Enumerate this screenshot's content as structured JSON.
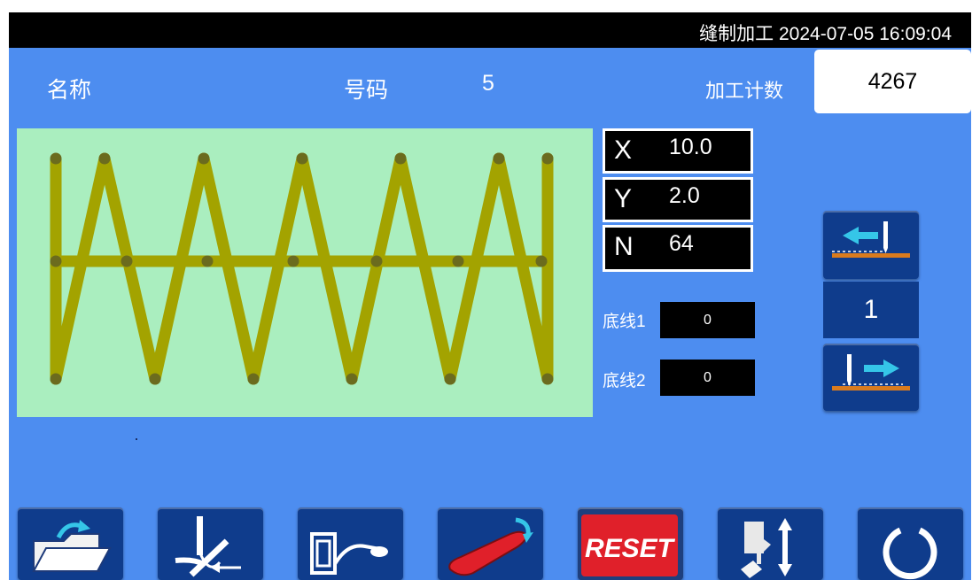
{
  "status": {
    "mode": "缝制加工",
    "datetime": "2024-07-05 16:09:04"
  },
  "header": {
    "name_label": "名称",
    "number_label": "号码",
    "number_value": "5",
    "count_label": "加工计数",
    "count_value": "4267"
  },
  "coords": {
    "x_label": "X",
    "x_value": "10.0",
    "y_label": "Y",
    "y_value": "2.0",
    "n_label": "N",
    "n_value": "64"
  },
  "bobbin": {
    "b1_label": "底线1",
    "b1_value": "0",
    "b2_label": "底线2",
    "b2_value": "0"
  },
  "stepper": {
    "value": "1"
  },
  "toolbar": {
    "reset_label": "RESET"
  },
  "icons": [
    "folder-open-icon",
    "thread-trim-icon",
    "clamp-icon",
    "presser-foot-icon",
    "reset-icon",
    "needle-up-down-icon",
    "power-cycle-icon",
    "needle-back-icon",
    "needle-forward-icon"
  ],
  "colors": {
    "status_bar": "#000000",
    "panel_bg": "#4d8df0",
    "pattern_bg": "#aaeebf",
    "stitch_line": "#a3a300",
    "stitch_point": "#6b6b1e",
    "button_bg": "#0f3c8c",
    "reset_red": "#e0202a"
  }
}
